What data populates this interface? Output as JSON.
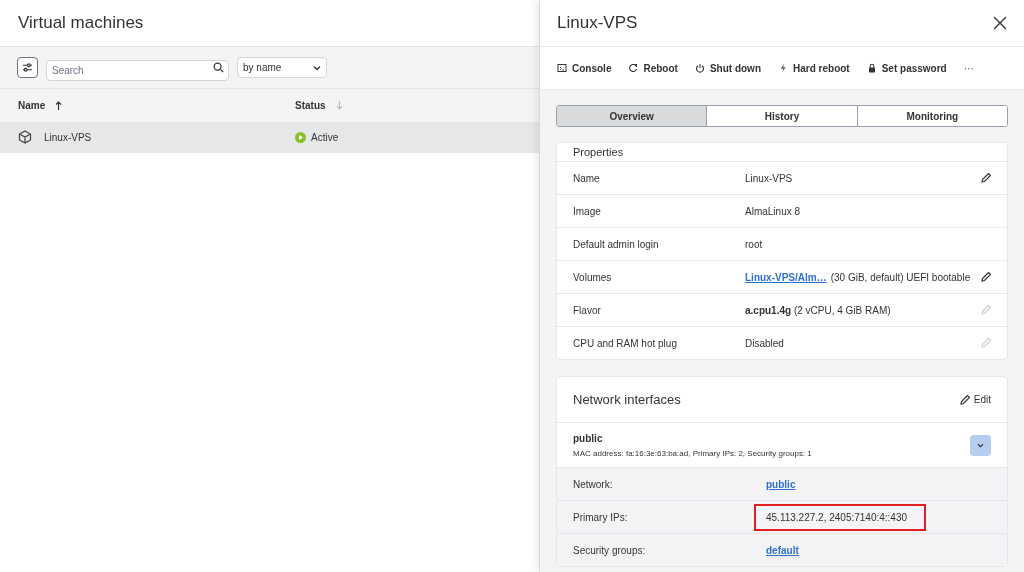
{
  "list_panel": {
    "title": "Virtual machines",
    "search": {
      "placeholder": "Search"
    },
    "sort": {
      "value": "by name"
    },
    "columns": [
      {
        "label": "Name",
        "sorted": true
      },
      {
        "label": "Status",
        "sorted": false
      }
    ],
    "rows": [
      {
        "name": "Linux-VPS",
        "status": "Active",
        "selected": true
      }
    ]
  },
  "detail_panel": {
    "title": "Linux-VPS",
    "actions": [
      {
        "kind": "console",
        "label": "Console"
      },
      {
        "kind": "reboot",
        "label": "Reboot"
      },
      {
        "kind": "power",
        "label": "Shut down"
      },
      {
        "kind": "bolt",
        "label": "Hard reboot"
      },
      {
        "kind": "lock",
        "label": "Set password"
      },
      {
        "kind": "more",
        "label": "···"
      }
    ],
    "tabs": [
      {
        "label": "Overview",
        "selected": true
      },
      {
        "label": "History",
        "selected": false
      },
      {
        "label": "Monitoring",
        "selected": false
      }
    ],
    "properties": {
      "title": "Properties",
      "rows": [
        {
          "label": "Name",
          "value": "Linux-VPS",
          "editable": true,
          "disabled": false
        },
        {
          "label": "Image",
          "value": "AlmaLinux 8",
          "editable": false
        },
        {
          "label": "Default admin login",
          "value": "root",
          "editable": false
        },
        {
          "label": "Volumes",
          "link": "Linux-VPS/Alm…",
          "value": "(30 GiB, default) UEFI bootable",
          "editable": true,
          "disabled": false
        },
        {
          "label": "Flavor",
          "value": "**a.cpu1.4g** (2 vCPU, 4 GiB RAM)",
          "editable": true,
          "disabled": true
        },
        {
          "label": "CPU and RAM hot plug",
          "value": "Disabled",
          "editable": true,
          "disabled": true
        }
      ]
    },
    "network": {
      "title": "Network interfaces",
      "edit_label": "Edit",
      "interface": {
        "name": "public",
        "summary": "MAC address: fa:16:3e:63:ba:ad, Primary IPs: 2, Security groups: 1",
        "expanded": true
      },
      "rows": [
        {
          "label": "Network:",
          "value": "public",
          "kind": "link",
          "highlighted": false
        },
        {
          "label": "Primary IPs:",
          "value": "45.113.227.2, 2405:7140:4::430",
          "kind": "text",
          "highlighted": true
        },
        {
          "label": "Security groups:",
          "value": "default",
          "kind": "link",
          "highlighted": false
        }
      ]
    }
  }
}
